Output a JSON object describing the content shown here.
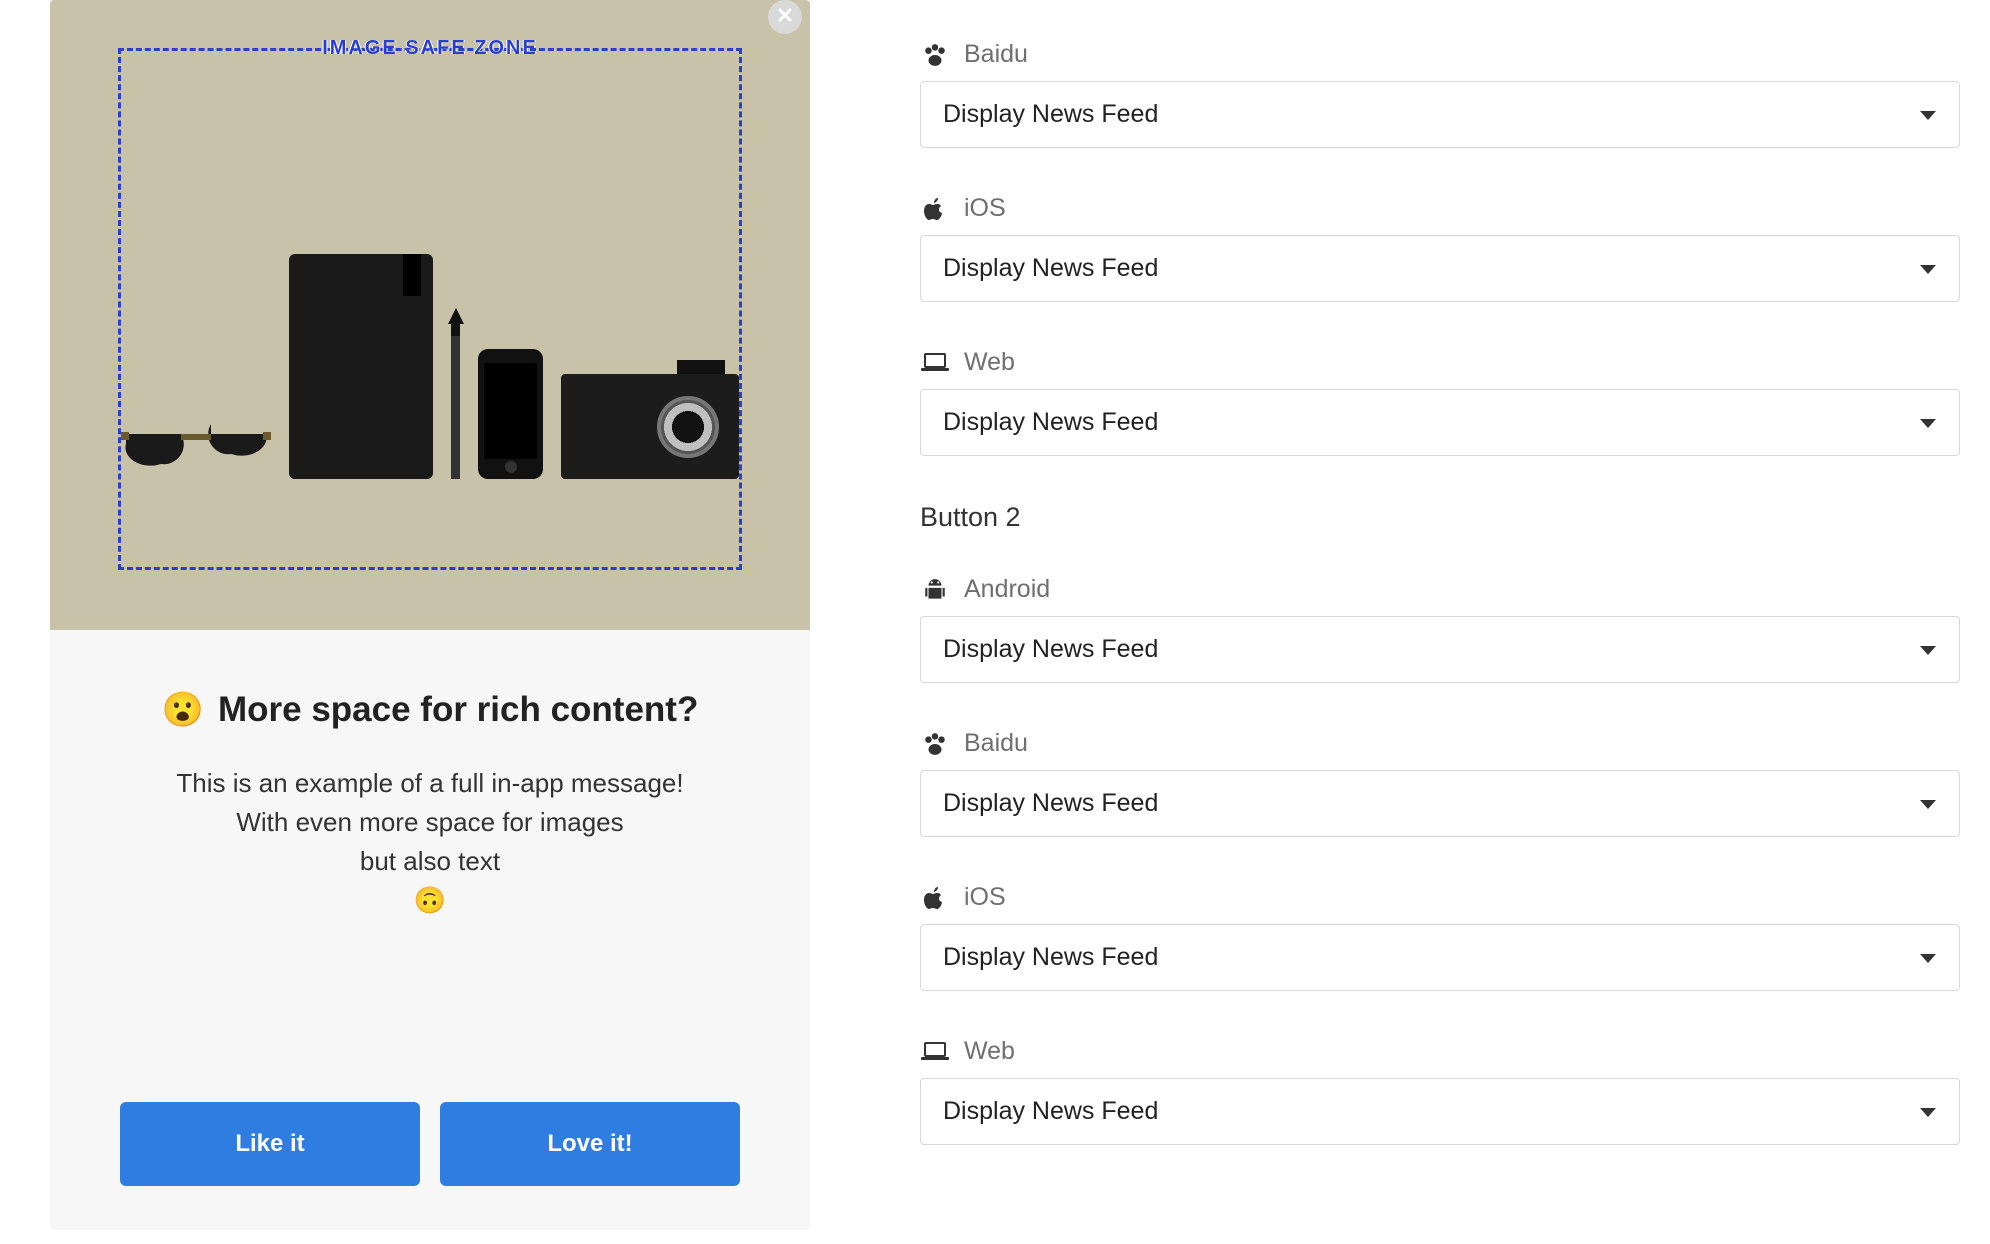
{
  "preview": {
    "safe_zone_label": "IMAGE SAFE ZONE",
    "title_emoji": "😮",
    "title": "More space for rich content?",
    "body_line1": "This is an example of a full in-app message!",
    "body_line2": "With even more space for images",
    "body_line3": "but also text",
    "body_emoji": "🙃",
    "button1": "Like it",
    "button2": "Love it!"
  },
  "form": {
    "section2_heading": "Button 2",
    "groups1": [
      {
        "platform": "Baidu",
        "icon": "paw",
        "value": "Display News Feed"
      },
      {
        "platform": "iOS",
        "icon": "apple",
        "value": "Display News Feed"
      },
      {
        "platform": "Web",
        "icon": "laptop",
        "value": "Display News Feed"
      }
    ],
    "groups2": [
      {
        "platform": "Android",
        "icon": "android",
        "value": "Display News Feed"
      },
      {
        "platform": "Baidu",
        "icon": "paw",
        "value": "Display News Feed"
      },
      {
        "platform": "iOS",
        "icon": "apple",
        "value": "Display News Feed"
      },
      {
        "platform": "Web",
        "icon": "laptop",
        "value": "Display News Feed"
      }
    ]
  }
}
